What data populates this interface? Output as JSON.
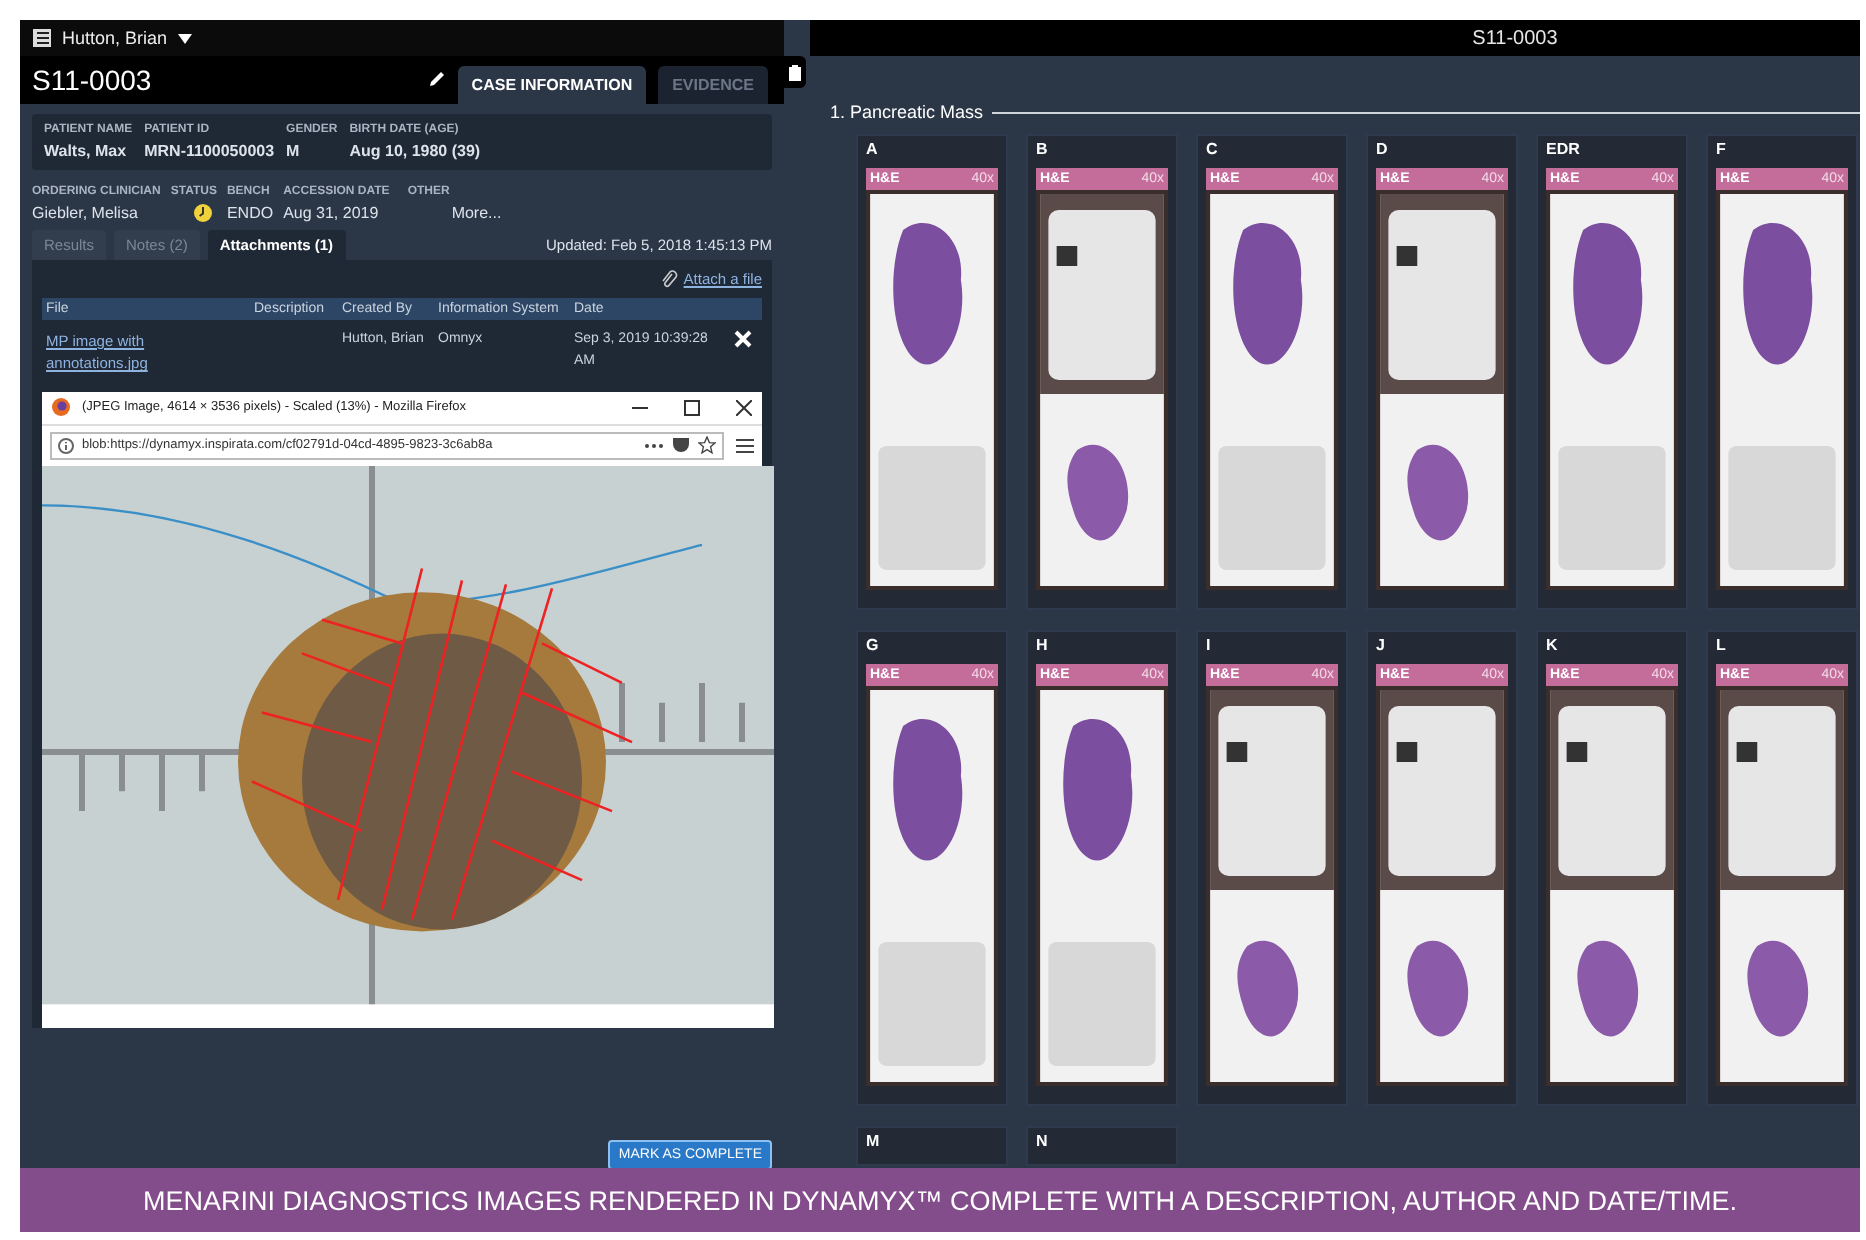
{
  "user_menu": {
    "label": "Hutton, Brian"
  },
  "case": {
    "id": "S11-0003",
    "tabs": [
      {
        "label": "CASE INFORMATION",
        "selected": true
      },
      {
        "label": "EVIDENCE",
        "selected": false
      }
    ]
  },
  "patient": {
    "fields": [
      {
        "label": "PATIENT NAME",
        "value": "Walts, Max"
      },
      {
        "label": "PATIENT ID",
        "value": "MRN-1100050003"
      },
      {
        "label": "GENDER",
        "value": "M"
      },
      {
        "label": "BIRTH DATE (AGE)",
        "value": "Aug 10, 1980 (39)"
      }
    ]
  },
  "order": {
    "fields": [
      {
        "label": "ORDERING CLINICIAN",
        "value": "Giebler, Melisa",
        "kind": "text"
      },
      {
        "label": "STATUS",
        "kind": "status"
      },
      {
        "label": "BENCH",
        "value": "ENDO",
        "kind": "text"
      },
      {
        "label": "ACCESSION DATE",
        "value": "Aug 31, 2019",
        "kind": "text"
      },
      {
        "label": "OTHER",
        "value": "More...",
        "kind": "text"
      }
    ]
  },
  "subtabs": [
    {
      "label": "Results",
      "selected": false
    },
    {
      "label": "Notes (2)",
      "selected": false
    },
    {
      "label": "Attachments (1)",
      "selected": true
    }
  ],
  "updated": "Updated: Feb 5, 2018 1:45:13 PM",
  "attachments": {
    "attach_link": "Attach a file",
    "columns": [
      "File",
      "Description",
      "Created By",
      "Information System",
      "Date"
    ],
    "rows": [
      {
        "file": "MP image with annotations.jpg",
        "created_by": "Hutton, Brian",
        "system": "Omnyx",
        "date": "Sep 3, 2019 10:39:28 AM"
      }
    ]
  },
  "viewer_window": {
    "title": "(JPEG Image, 4614 × 3536 pixels) - Scaled (13%) - Mozilla Firefox",
    "url": "blob:https://dynamyx.inspirata.com/cf02791d-04cd-4895-9823-3c6ab8a"
  },
  "mark_complete": "MARK AS COMPLETE",
  "viewer": {
    "title": "S11-0003",
    "section": "1. Pancreatic Mass",
    "slides": [
      {
        "label": "A",
        "stain": "H&E",
        "magnification": "40x",
        "kind": "tissue"
      },
      {
        "label": "B",
        "stain": "H&E",
        "magnification": "40x",
        "kind": "label"
      },
      {
        "label": "C",
        "stain": "H&E",
        "magnification": "40x",
        "kind": "tissue"
      },
      {
        "label": "D",
        "stain": "H&E",
        "magnification": "40x",
        "kind": "label"
      },
      {
        "label": "EDR",
        "stain": "H&E",
        "magnification": "40x",
        "kind": "tissue"
      },
      {
        "label": "F",
        "stain": "H&E",
        "magnification": "40x",
        "kind": "tissue"
      },
      {
        "label": "G",
        "stain": "H&E",
        "magnification": "40x",
        "kind": "tissue"
      },
      {
        "label": "H",
        "stain": "H&E",
        "magnification": "40x",
        "kind": "tissue"
      },
      {
        "label": "I",
        "stain": "H&E",
        "magnification": "40x",
        "kind": "label"
      },
      {
        "label": "J",
        "stain": "H&E",
        "magnification": "40x",
        "kind": "label"
      },
      {
        "label": "K",
        "stain": "H&E",
        "magnification": "40x",
        "kind": "label"
      },
      {
        "label": "L",
        "stain": "H&E",
        "magnification": "40x",
        "kind": "label"
      },
      {
        "label": "M",
        "kind": "partial"
      },
      {
        "label": "N",
        "kind": "partial"
      }
    ]
  },
  "caption": "MENARINI DIAGNOSTICS IMAGES RENDERED IN DYNAMYX™ COMPLETE WITH A DESCRIPTION, AUTHOR AND DATE/TIME."
}
